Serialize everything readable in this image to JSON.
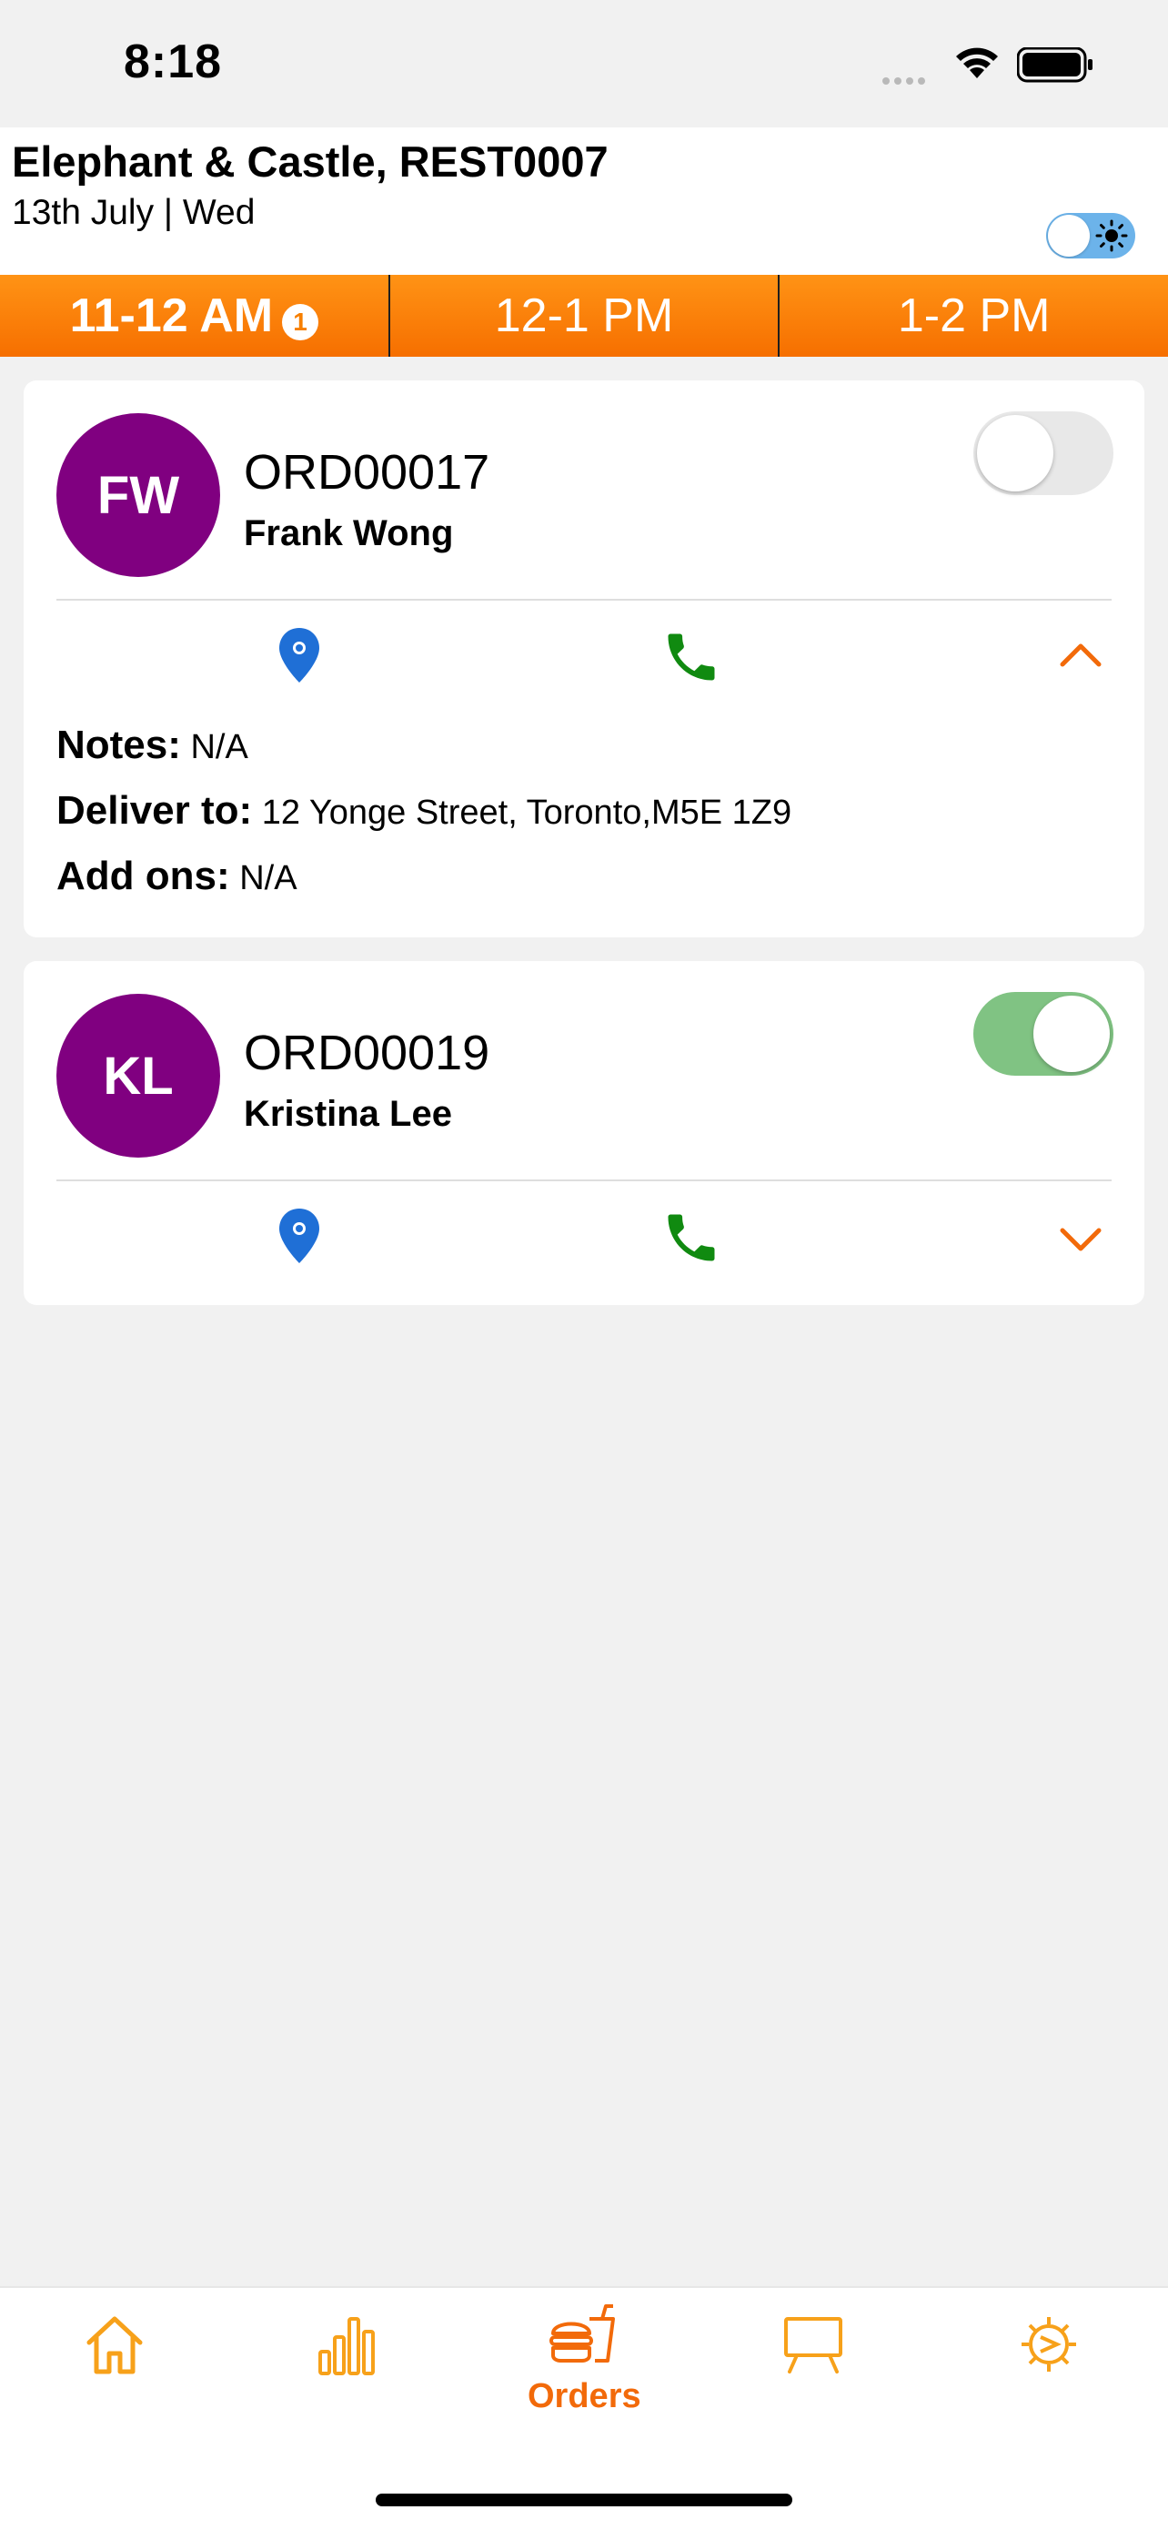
{
  "status_bar": {
    "time": "8:18"
  },
  "header": {
    "title": "Elephant & Castle, REST0007",
    "date": "13th July | Wed",
    "theme_toggle_icon": "sun-icon"
  },
  "time_slots": [
    {
      "label": "11-12 AM",
      "badge": "1",
      "active": true
    },
    {
      "label": "12-1 PM",
      "active": false
    },
    {
      "label": "1-2 PM",
      "active": false
    }
  ],
  "orders": [
    {
      "initials": "FW",
      "order_id": "ORD00017",
      "customer": "Frank Wong",
      "accepted": false,
      "expanded": true,
      "notes_label": "Notes:",
      "notes": "N/A",
      "deliver_label": "Deliver to:",
      "deliver_to": "12 Yonge Street, Toronto,M5E 1Z9",
      "addons_label": "Add ons:",
      "addons": "N/A"
    },
    {
      "initials": "KL",
      "order_id": "ORD00019",
      "customer": "Kristina Lee",
      "accepted": true,
      "expanded": false
    }
  ],
  "tab_bar": {
    "active_label": "Orders",
    "tabs": [
      "home-icon",
      "stats-icon",
      "orders-icon",
      "board-icon",
      "settings-icon"
    ]
  },
  "colors": {
    "accent": "#f77f00",
    "avatar": "#800080",
    "location": "#1f6fd6",
    "phone": "#108a10",
    "toggle_on": "#80c383"
  }
}
